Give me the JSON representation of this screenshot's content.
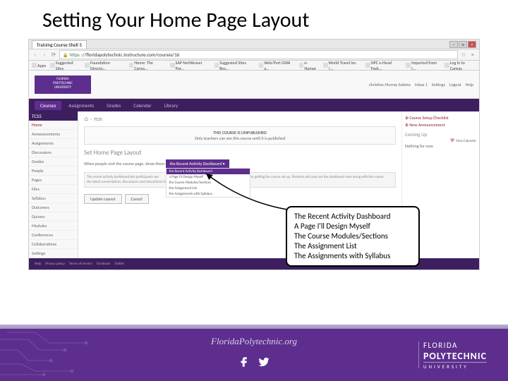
{
  "slide_title": "Setting Your Home Page Layout",
  "browser": {
    "tab_title": "Training Course Shell 5",
    "url_https": "https",
    "url_rest": "://floridapolytechnic.instructure.com/courses/16",
    "bookmarks": [
      "Apps",
      "Suggested Sites",
      "Foundation Directo...",
      "Home: The Canva...",
      "SAP NetWeaver Por...",
      "Suggested Sites Bes...",
      "Web/Part GWA a...",
      "e-Humor",
      "World Travel Inc. |...",
      "NPC e-Head Pack...",
      "Imported from I...",
      "Log In to Canvas"
    ]
  },
  "canvas": {
    "header_right": [
      "christine.Murray-Sobota",
      "Inbox 1",
      "Settings",
      "Logout",
      "Help"
    ],
    "nav": [
      "Courses",
      "Assignments",
      "Grades",
      "Calendar",
      "Library"
    ],
    "course_code": "TCS5",
    "sidebar": [
      "Home",
      "Announcements",
      "Assignments",
      "Discussions",
      "Grades",
      "People",
      "Pages",
      "Files",
      "Syllabus",
      "Outcomes",
      "Quizzes",
      "Modules",
      "Conferences",
      "Collaborations",
      "Settings"
    ],
    "breadcrumb": "TCS5",
    "unpublished_title": "THIS COURSE IS UNPUBLISHED",
    "unpublished_sub": "Only teachers can see this course until it is published",
    "section_title": "Set Home Page Layout",
    "form_label": "When people visit the course page, show them",
    "dropdown_selected": "the Recent Activity Dashboard",
    "dropdown_items": [
      "the Recent Activity Dashboard",
      "a Page I'll Design Myself",
      "the Course Modules/Sections",
      "the Assignment List",
      "the Assignments with Syllabus"
    ],
    "desc1": "The recent activity dashboard lets participants see",
    "desc2": "the latest conversations, discussions and interactions for this",
    "desc_side": "course as well as some Quick Start options for getting the course set up. Students will only see the dashboard view along with the course sidebar.",
    "btn_update": "Update Layout",
    "btn_cancel": "Cancel",
    "right_panel": {
      "setup": "Course Setup Checklist",
      "new_announce": "New Announcement",
      "coming_up": "Coming Up",
      "view_cal": "View Calendar",
      "nothing": "Nothing for now"
    },
    "footer_links": [
      "Help",
      "Privacy policy",
      "Terms of service",
      "Facebook",
      "Twitter"
    ]
  },
  "callout": {
    "l1": "The Recent Activity Dashboard",
    "l2": "A Page I'll Design Myself",
    "l3": "The Course Modules/Sections",
    "l4": "The Assignment List",
    "l5": "The Assignments with Syllabus"
  },
  "footer": {
    "url": "FloridaPolytechnic.org",
    "logo_top": "FLORIDA",
    "logo_mid": "POLYTECHNIC",
    "logo_bot": "UNIVERSITY"
  }
}
